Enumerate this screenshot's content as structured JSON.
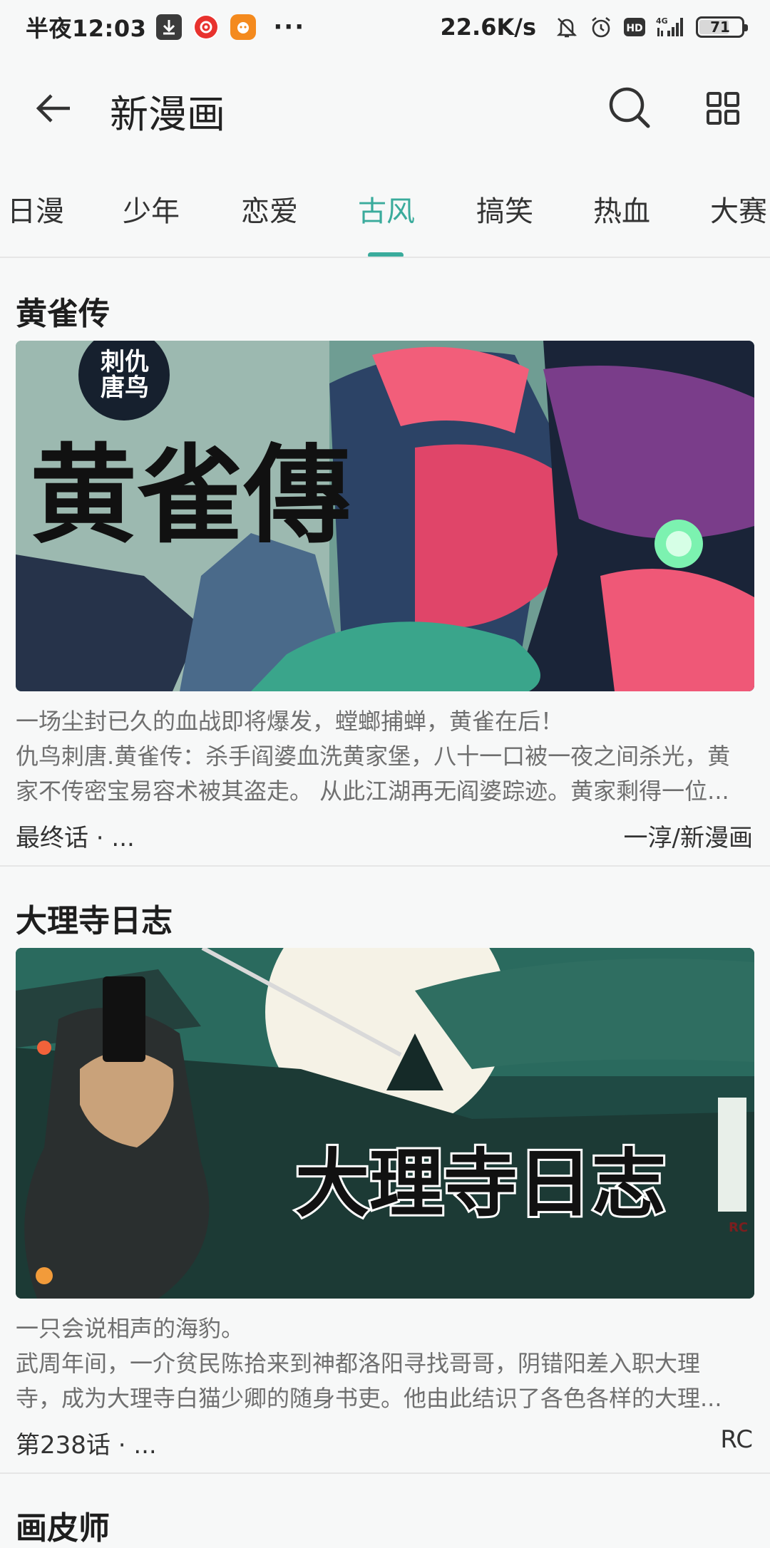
{
  "status_bar": {
    "time": "半夜12:03",
    "dots": "···",
    "speed": "22.6K/s",
    "hd": "HD",
    "net": "4G",
    "battery": "71",
    "battery_level": 0.71
  },
  "header": {
    "title": "新漫画"
  },
  "tabs": [
    {
      "label": "日漫"
    },
    {
      "label": "少年"
    },
    {
      "label": "恋爱"
    },
    {
      "label": "古风",
      "active": true
    },
    {
      "label": "搞笑"
    },
    {
      "label": "热血"
    },
    {
      "label": "大赛"
    }
  ],
  "comics": [
    {
      "title": "黄雀传",
      "cover_text": "黄雀傳",
      "cover_seal": "刺仇唐鸟",
      "desc_lines": [
        "一场尘封已久的血战即将爆发，螳螂捕蝉，黄雀在后！",
        "仇鸟刺唐.黄雀传：杀手阎婆血洗黄家堡，八十一口被一夜之间杀光，黄",
        "家不传密宝易容术被其盗走。 从此江湖再无阎婆踪迹。黄家剩得一位..."
      ],
      "chapter": "最终话 · ...",
      "author": "一淳/新漫画"
    },
    {
      "title": "大理寺日志",
      "cover_text": "大理寺日志",
      "cover_seal": "RC",
      "desc_lines": [
        "一只会说相声的海豹。",
        "武周年间，一介贫民陈拾来到神都洛阳寻找哥哥，阴错阳差入职大理",
        "寺，成为大理寺白猫少卿的随身书吏。他由此结识了各色各样的大理..."
      ],
      "chapter": "第238话 · ...",
      "author": "RC"
    },
    {
      "title": "画皮师"
    }
  ],
  "colors": {
    "accent": "#3aab9c",
    "background": "#f7f8f8"
  }
}
